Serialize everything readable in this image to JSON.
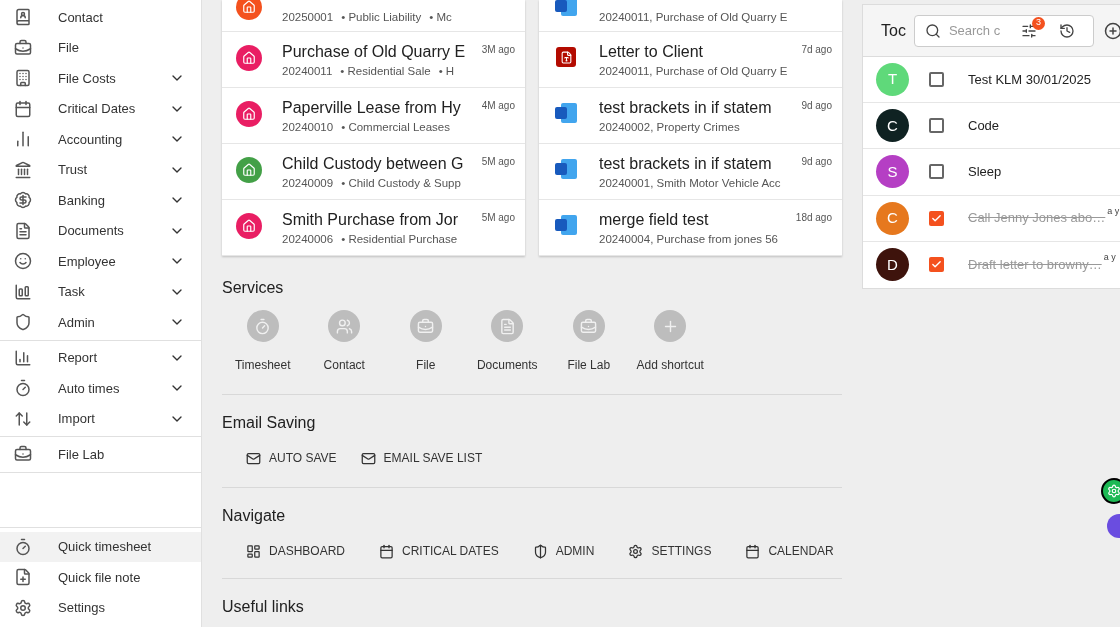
{
  "sidebar": {
    "groups": [
      [
        {
          "label": "Contact",
          "expandable": false
        },
        {
          "label": "File",
          "expandable": false
        },
        {
          "label": "File Costs",
          "expandable": true
        },
        {
          "label": "Critical Dates",
          "expandable": true
        },
        {
          "label": "Accounting",
          "expandable": true
        },
        {
          "label": "Trust",
          "expandable": true
        },
        {
          "label": "Banking",
          "expandable": true
        },
        {
          "label": "Documents",
          "expandable": true
        },
        {
          "label": "Employee",
          "expandable": true
        },
        {
          "label": "Task",
          "expandable": true
        },
        {
          "label": "Admin",
          "expandable": true
        }
      ],
      [
        {
          "label": "Report",
          "expandable": true
        },
        {
          "label": "Auto times",
          "expandable": true
        },
        {
          "label": "Import",
          "expandable": true
        }
      ],
      [
        {
          "label": "File Lab",
          "expandable": false
        }
      ]
    ],
    "footer": [
      {
        "label": "Quick timesheet",
        "selected": true
      },
      {
        "label": "Quick file note",
        "selected": false
      },
      {
        "label": "Settings",
        "selected": false
      }
    ]
  },
  "recent_files": [
    {
      "number": "20250001",
      "tags": [
        "• Public Liability",
        "• Mc"
      ],
      "color": "#f4511e"
    },
    {
      "title": "Purchase of Old Quarry E",
      "number": "20240011",
      "tags": [
        "• Residential Sale",
        "• H"
      ],
      "time": "3M ago",
      "color": "#e91e63"
    },
    {
      "title": "Paperville Lease from Hy",
      "number": "20240010",
      "tags": [
        "• Commercial Leases"
      ],
      "time": "4M ago",
      "color": "#e91e63"
    },
    {
      "title": "Child Custody between G",
      "number": "20240009",
      "tags": [
        "• Child Custody & Supp"
      ],
      "time": "5M ago",
      "color": "#43a047"
    },
    {
      "title": "Smith Purchase from Jor",
      "number": "20240006",
      "tags": [
        "• Residential Purchase"
      ],
      "time": "5M ago",
      "color": "#e91e63"
    }
  ],
  "recent_documents": [
    {
      "kind": "word",
      "subtitle": "20240011, Purchase of Old Quarry E"
    },
    {
      "kind": "pdf",
      "title": "Letter to Client",
      "subtitle": "20240011, Purchase of Old Quarry E",
      "time": "7d ago"
    },
    {
      "kind": "word",
      "title": "test brackets in if statem",
      "subtitle": "20240002, Property Crimes",
      "time": "9d ago"
    },
    {
      "kind": "word",
      "title": "test brackets in if statem",
      "subtitle": "20240001, Smith Motor Vehicle Acc",
      "time": "9d ago"
    },
    {
      "kind": "word",
      "title": "merge field test",
      "subtitle": "20240004, Purchase from jones 56",
      "time": "18d ago"
    }
  ],
  "services": {
    "title": "Services",
    "items": [
      {
        "label": "Timesheet"
      },
      {
        "label": "Contact"
      },
      {
        "label": "File"
      },
      {
        "label": "Documents"
      },
      {
        "label": "File Lab"
      },
      {
        "label": "Add shortcut"
      }
    ]
  },
  "email_saving": {
    "title": "Email Saving",
    "buttons": [
      {
        "label": "AUTO SAVE"
      },
      {
        "label": "EMAIL SAVE LIST"
      }
    ]
  },
  "navigate": {
    "title": "Navigate",
    "buttons": [
      {
        "label": "DASHBOARD"
      },
      {
        "label": "CRITICAL DATES"
      },
      {
        "label": "ADMIN"
      },
      {
        "label": "SETTINGS"
      },
      {
        "label": "CALENDAR"
      }
    ]
  },
  "useful_links": {
    "title": "Useful links"
  },
  "todo": {
    "title": "Toc",
    "search": {
      "placeholder": "Search c"
    },
    "filter_badge": "3",
    "items": [
      {
        "initial": "T",
        "color": "#5fd97a",
        "checked": false,
        "text": "Test KLM 30/01/2025"
      },
      {
        "initial": "C",
        "color": "#0f2222",
        "checked": false,
        "text": "Code"
      },
      {
        "initial": "S",
        "color": "#b53fc4",
        "checked": false,
        "text": "Sleep"
      },
      {
        "initial": "C",
        "color": "#e6781e",
        "checked": true,
        "text": "Call Jenny Jones abo…",
        "time": "a y"
      },
      {
        "initial": "D",
        "color": "#3e130c",
        "checked": true,
        "text": "Draft letter to browny…",
        "time": "a y"
      }
    ]
  }
}
